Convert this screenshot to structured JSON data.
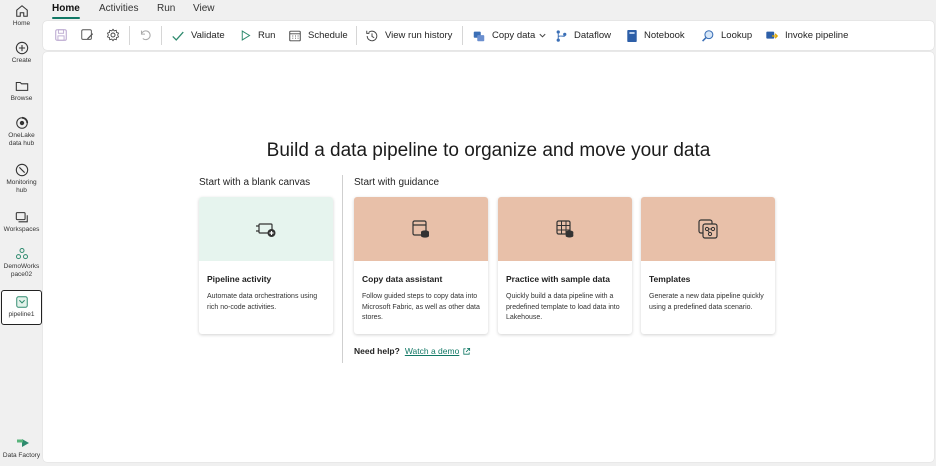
{
  "rail": {
    "items": [
      {
        "label_1": "Home",
        "label_2": ""
      },
      {
        "label_1": "Create",
        "label_2": ""
      },
      {
        "label_1": "Browse",
        "label_2": ""
      },
      {
        "label_1": "OneLake",
        "label_2": "data hub"
      },
      {
        "label_1": "Monitoring",
        "label_2": "hub"
      },
      {
        "label_1": "Workspaces",
        "label_2": ""
      },
      {
        "label_1": "DemoWorks",
        "label_2": "pace02"
      },
      {
        "label_1": "pipeline1",
        "label_2": ""
      }
    ],
    "footer": "Data Factory"
  },
  "menu": {
    "tabs": [
      "Home",
      "Activities",
      "Run",
      "View"
    ],
    "active": "Home"
  },
  "toolbar": {
    "validate": "Validate",
    "run": "Run",
    "schedule": "Schedule",
    "view_run_history": "View run history",
    "copy_data": "Copy data",
    "dataflow": "Dataflow",
    "notebook": "Notebook",
    "lookup": "Lookup",
    "invoke_pipeline": "Invoke pipeline"
  },
  "main": {
    "headline": "Build a data pipeline to organize and move your data",
    "blank_section": "Start with a blank canvas",
    "guidance_section": "Start with guidance",
    "cards": [
      {
        "title": "Pipeline activity",
        "desc": "Automate data orchestrations using rich no-code activities."
      },
      {
        "title": "Copy data assistant",
        "desc": "Follow guided steps to copy data into Microsoft Fabric, as well as other data stores."
      },
      {
        "title": "Practice with sample data",
        "desc": "Quickly build a data pipeline with a predefined template to load data into Lakehouse."
      },
      {
        "title": "Templates",
        "desc": "Generate a new data pipeline quickly using a predefined data scenario."
      }
    ],
    "help_label": "Need help?",
    "help_link": "Watch a demo"
  },
  "colors": {
    "accent": "#117865",
    "blank_card_bg": "#e6f4ee",
    "guidance_card_bg": "#e8c0a9"
  }
}
